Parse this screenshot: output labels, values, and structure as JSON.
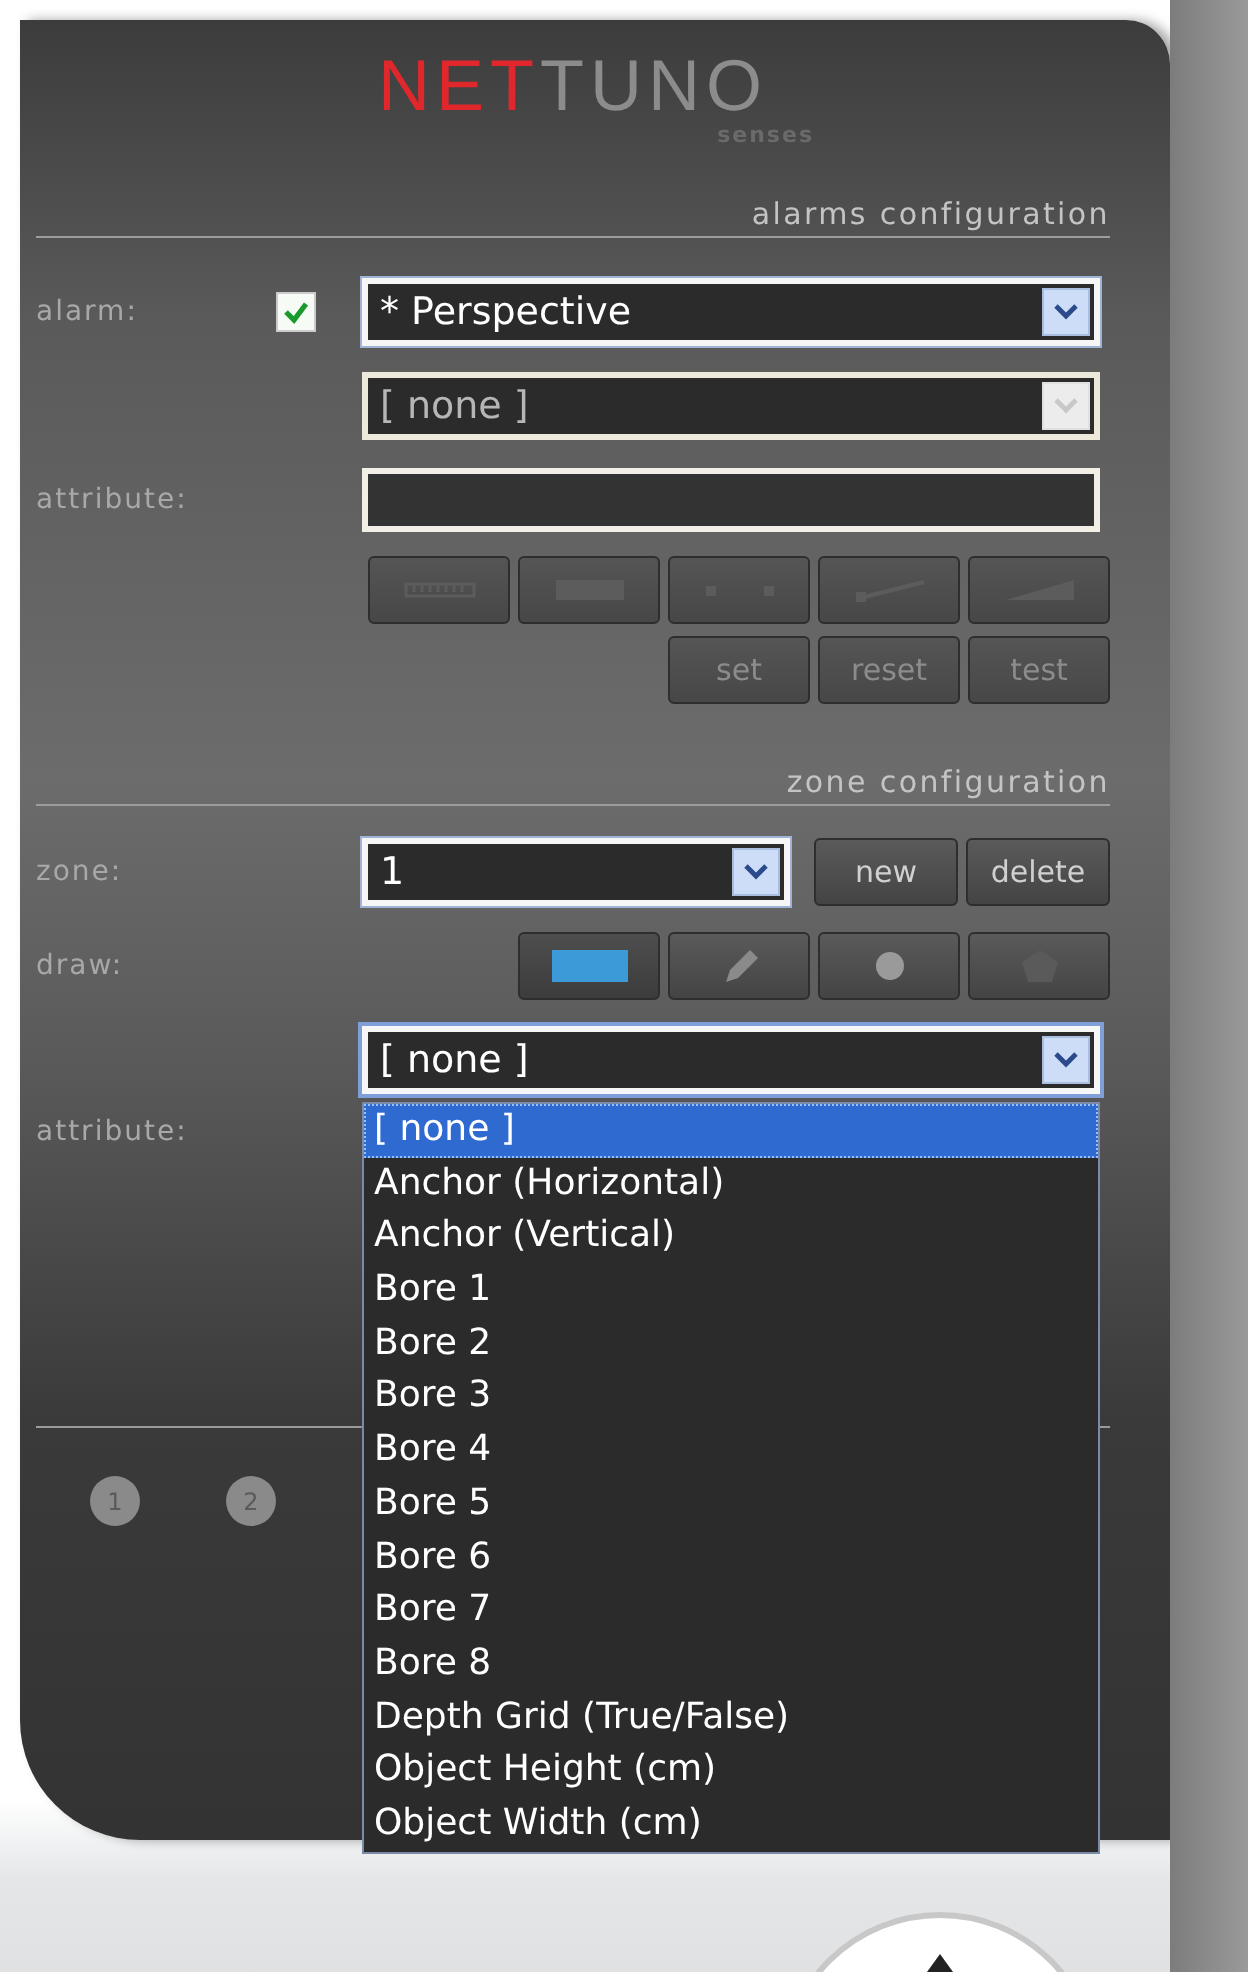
{
  "logo": {
    "parts": [
      {
        "text": "NET",
        "color": "#e0282c"
      },
      {
        "text": "TUNO",
        "color": "#8c8c8c"
      }
    ],
    "tagline": "senses"
  },
  "alarms": {
    "heading": "alarms configuration",
    "alarm_label": "alarm:",
    "alarm_checked": true,
    "alarm_select": {
      "value": "* Perspective",
      "disabled": false
    },
    "sub_select": {
      "value": "[ none ]",
      "disabled": true
    },
    "attribute_label": "attribute:",
    "tools": [
      {
        "kind": "ruler",
        "disabled": true
      },
      {
        "kind": "bar",
        "disabled": true
      },
      {
        "kind": "dots",
        "disabled": true
      },
      {
        "kind": "line",
        "disabled": true
      },
      {
        "kind": "ramp",
        "disabled": true
      }
    ],
    "actions": [
      {
        "label": "set",
        "disabled": true
      },
      {
        "label": "reset",
        "disabled": true
      },
      {
        "label": "test",
        "disabled": true
      }
    ]
  },
  "zone": {
    "heading": "zone configuration",
    "zone_label": "zone:",
    "zone_select": {
      "value": "1",
      "disabled": false
    },
    "buttons": [
      {
        "label": "new",
        "disabled": false
      },
      {
        "label": "delete",
        "disabled": false
      }
    ],
    "draw_label": "draw:",
    "draw_tools": [
      {
        "kind": "rectangle",
        "selected": true
      },
      {
        "kind": "pencil",
        "selected": false
      },
      {
        "kind": "circle",
        "selected": false
      },
      {
        "kind": "polygon",
        "selected": false
      }
    ],
    "attribute_label": "attribute:",
    "attribute_select": {
      "value": "[ none ]",
      "expanded": true,
      "options": [
        {
          "label": "[ none ]",
          "selected": true
        },
        {
          "label": "Anchor (Horizontal)",
          "selected": false
        },
        {
          "label": "Anchor (Vertical)",
          "selected": false
        },
        {
          "label": "Bore 1",
          "selected": false
        },
        {
          "label": "Bore 2",
          "selected": false
        },
        {
          "label": "Bore 3",
          "selected": false
        },
        {
          "label": "Bore 4",
          "selected": false
        },
        {
          "label": "Bore 5",
          "selected": false
        },
        {
          "label": "Bore 6",
          "selected": false
        },
        {
          "label": "Bore 7",
          "selected": false
        },
        {
          "label": "Bore 8",
          "selected": false
        },
        {
          "label": "Depth Grid (True/False)",
          "selected": false
        },
        {
          "label": "Object Height (cm)",
          "selected": false
        },
        {
          "label": "Object Width (cm)",
          "selected": false
        }
      ]
    }
  },
  "pages": [
    {
      "label": "1"
    },
    {
      "label": "2"
    }
  ]
}
